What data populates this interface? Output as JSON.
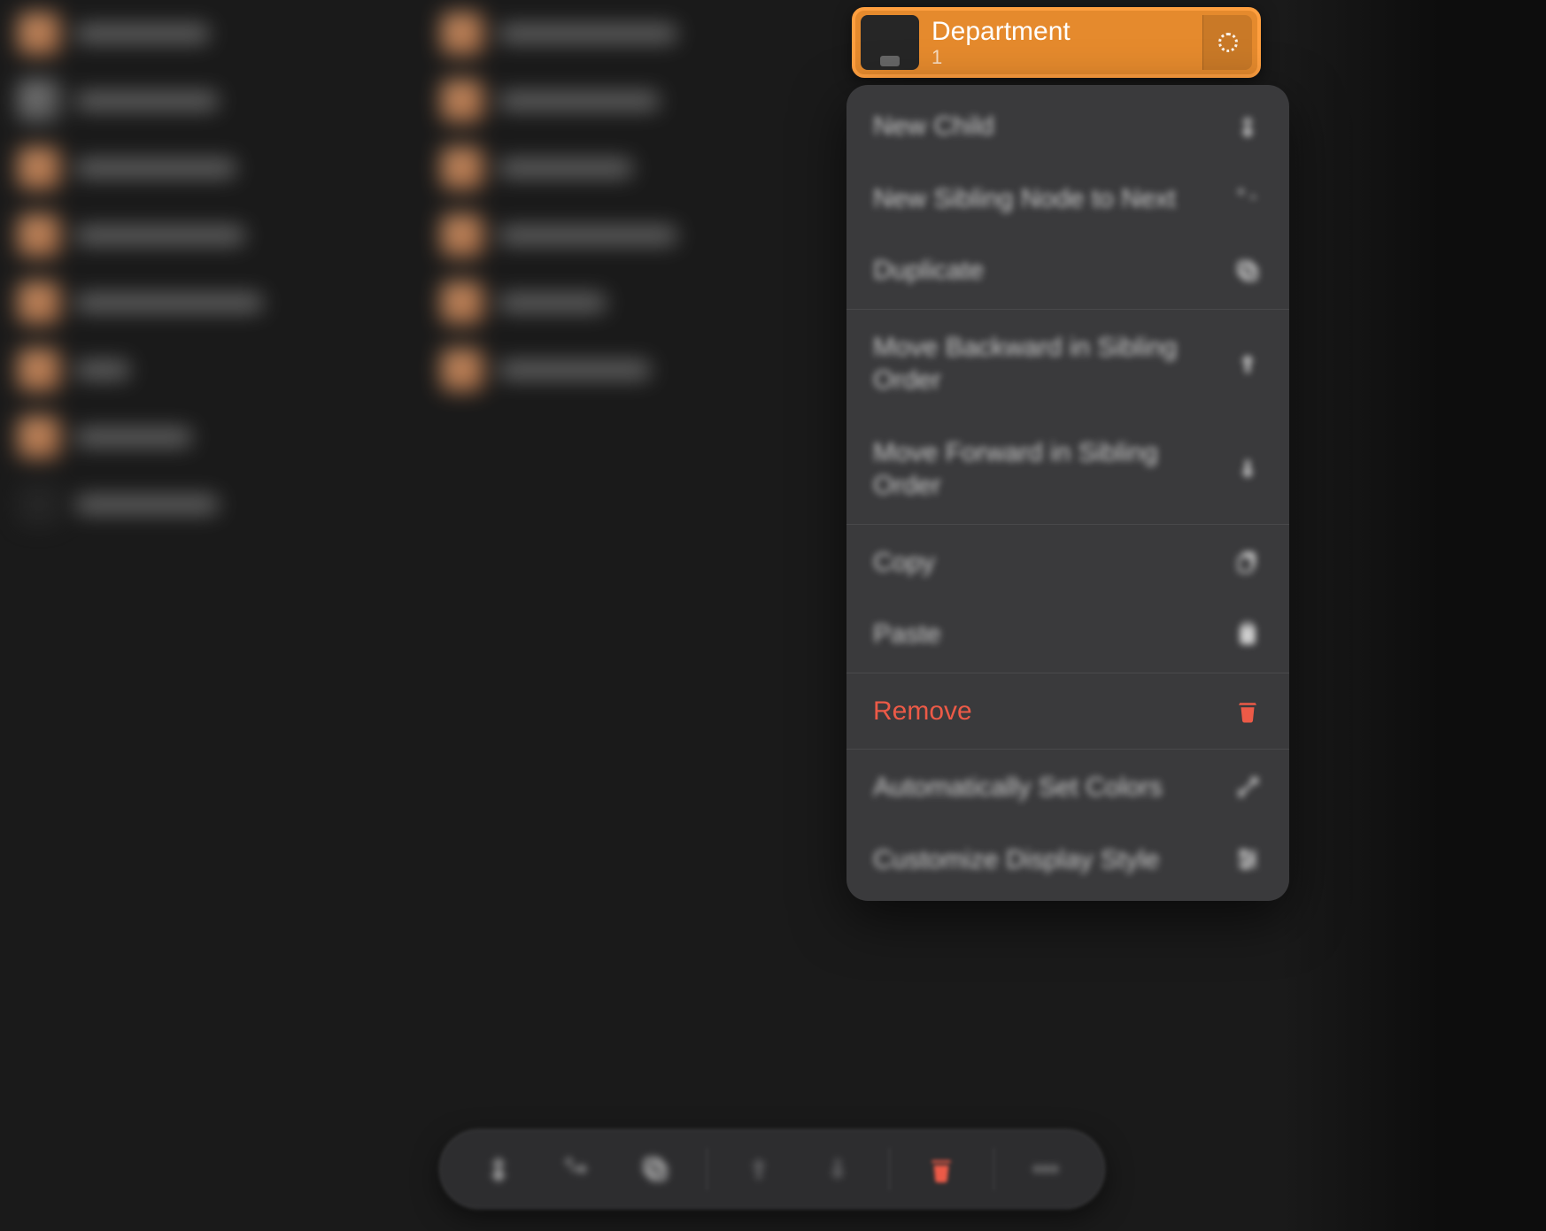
{
  "dept": {
    "title": "Department",
    "count": "1"
  },
  "menu": {
    "new_child": "New Child",
    "new_sibling": "New Sibling Node to Next",
    "duplicate": "Duplicate",
    "move_back": "Move Backward in Sibling Order",
    "move_fwd": "Move Forward in Sibling Order",
    "copy": "Copy",
    "paste": "Paste",
    "remove": "Remove",
    "auto_colors": "Automatically Set Colors",
    "customize": "Customize Display Style"
  },
  "bg": {
    "col1_widths": [
      150,
      160,
      180,
      190,
      210,
      60,
      130,
      160
    ],
    "col2_widths": [
      200,
      180,
      150,
      200,
      120,
      170
    ]
  }
}
